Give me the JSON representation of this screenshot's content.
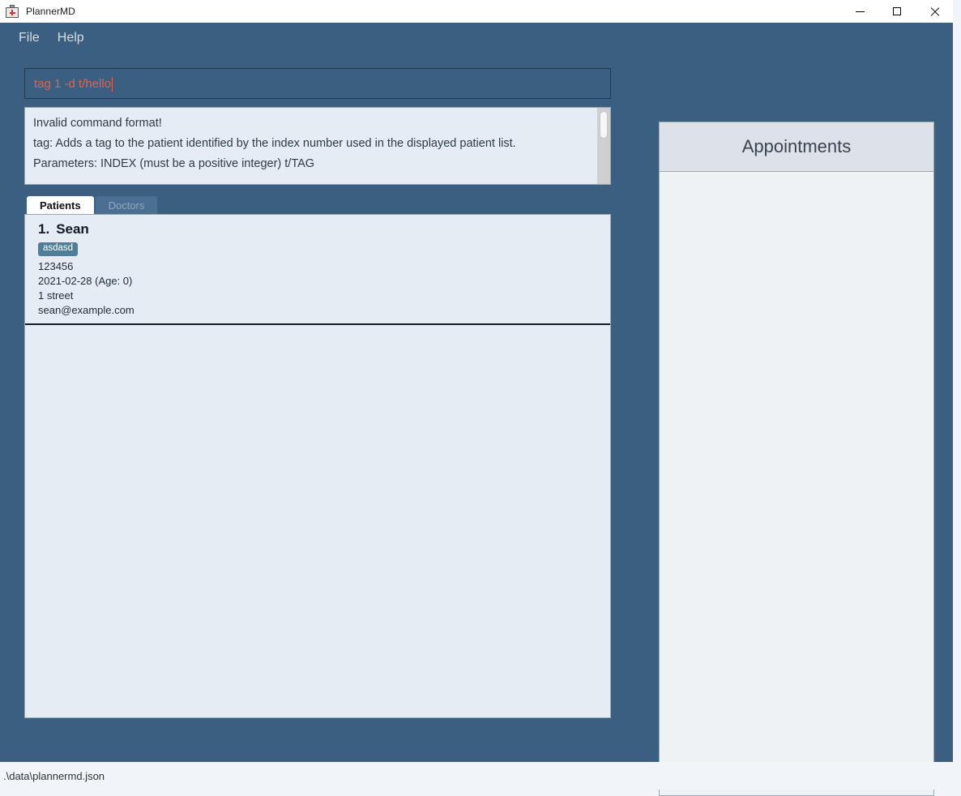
{
  "window": {
    "title": "PlannerMD",
    "icon": "first-aid-kit-icon",
    "controls": {
      "minimize": "–",
      "maximize": "☐",
      "close": "✕"
    }
  },
  "menu": {
    "items": [
      {
        "label": "File"
      },
      {
        "label": "Help"
      }
    ]
  },
  "command": {
    "value": "tag 1 -d t/hello",
    "text_color": "#e8604c"
  },
  "result": {
    "lines": [
      "Invalid command format!",
      "tag: Adds a tag to the patient identified by the index number used in the displayed patient list.",
      "Parameters: INDEX (must be a positive integer) t/TAG"
    ]
  },
  "tabs": [
    {
      "label": "Patients",
      "active": true
    },
    {
      "label": "Doctors",
      "active": false
    }
  ],
  "patients": [
    {
      "index": "1.",
      "name": "Sean",
      "tags": [
        "asdasd"
      ],
      "phone": "123456",
      "dob": "2021-02-28 (Age: 0)",
      "address": "1 street",
      "email": "sean@example.com"
    }
  ],
  "appointments": {
    "title": "Appointments",
    "items": []
  },
  "status": {
    "file_path": ".\\data\\plannermd.json"
  },
  "colors": {
    "window_background": "#3b5f80",
    "panel_background": "#e5ecf4",
    "appointments_header": "#dde2e8",
    "tag_badge": "#4d7f9b",
    "error_text": "#e8604c"
  }
}
